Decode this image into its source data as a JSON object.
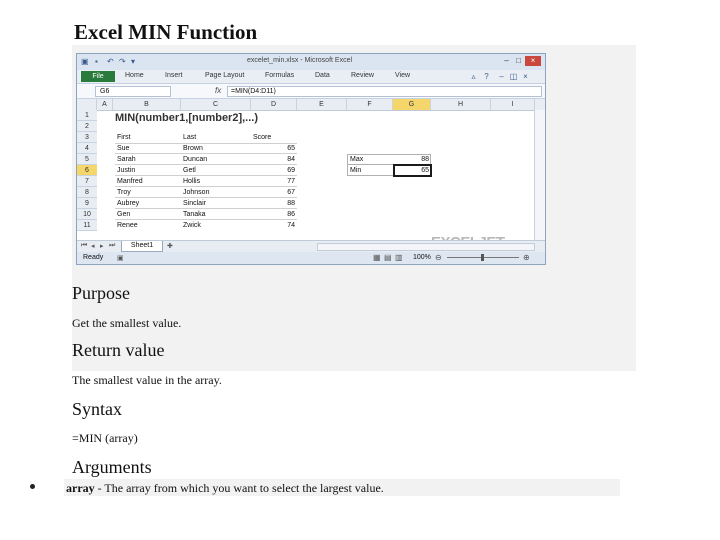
{
  "page": {
    "title": "Excel MIN Function",
    "purpose_heading": "Purpose",
    "purpose_text": "Get the smallest value.",
    "return_heading": "Return value",
    "return_text": "The smallest value in the array.",
    "syntax_heading": "Syntax",
    "syntax_text": "=MIN (array)",
    "arguments_heading": "Arguments",
    "argument_name": "array",
    "argument_desc": " - The array from which you want to select the largest value."
  },
  "excel": {
    "window_title": "excelet_min.xlsx - Microsoft Excel",
    "ribbon_tabs": [
      "File",
      "Home",
      "Insert",
      "Page Layout",
      "Formulas",
      "Data",
      "Review",
      "View"
    ],
    "name_box": "G6",
    "fx_label": "fx",
    "formula": "=MIN(D4:D11)",
    "columns": [
      "A",
      "B",
      "C",
      "D",
      "E",
      "F",
      "G",
      "H",
      "I"
    ],
    "selected_column": "G",
    "rows": [
      "1",
      "2",
      "3",
      "4",
      "5",
      "6",
      "7",
      "8",
      "9",
      "10",
      "11"
    ],
    "selected_row": "6",
    "syntax_cell": "MIN(number1,[number2],...)",
    "table_headers": [
      "First",
      "Last",
      "Score"
    ],
    "table_rows": [
      [
        "Sue",
        "Brown",
        "65"
      ],
      [
        "Sarah",
        "Duncan",
        "84"
      ],
      [
        "Justin",
        "Getl",
        "69"
      ],
      [
        "Manfred",
        "Hollis",
        "77"
      ],
      [
        "Troy",
        "Johnson",
        "67"
      ],
      [
        "Aubrey",
        "Sinclair",
        "88"
      ],
      [
        "Gen",
        "Tanaka",
        "86"
      ],
      [
        "Renee",
        "Zwick",
        "74"
      ]
    ],
    "summary": [
      {
        "label": "Max",
        "value": "88"
      },
      {
        "label": "Min",
        "value": "65"
      }
    ],
    "sheet_tab": "Sheet1",
    "status": "Ready",
    "zoom": "100%",
    "watermark": "EXCELJET"
  },
  "colors": {
    "page_background": "#ffffff",
    "panel_background": "#f2f2f2",
    "excel_file_tab": "#2a7a3c",
    "selection_header": "#f5d66b"
  }
}
